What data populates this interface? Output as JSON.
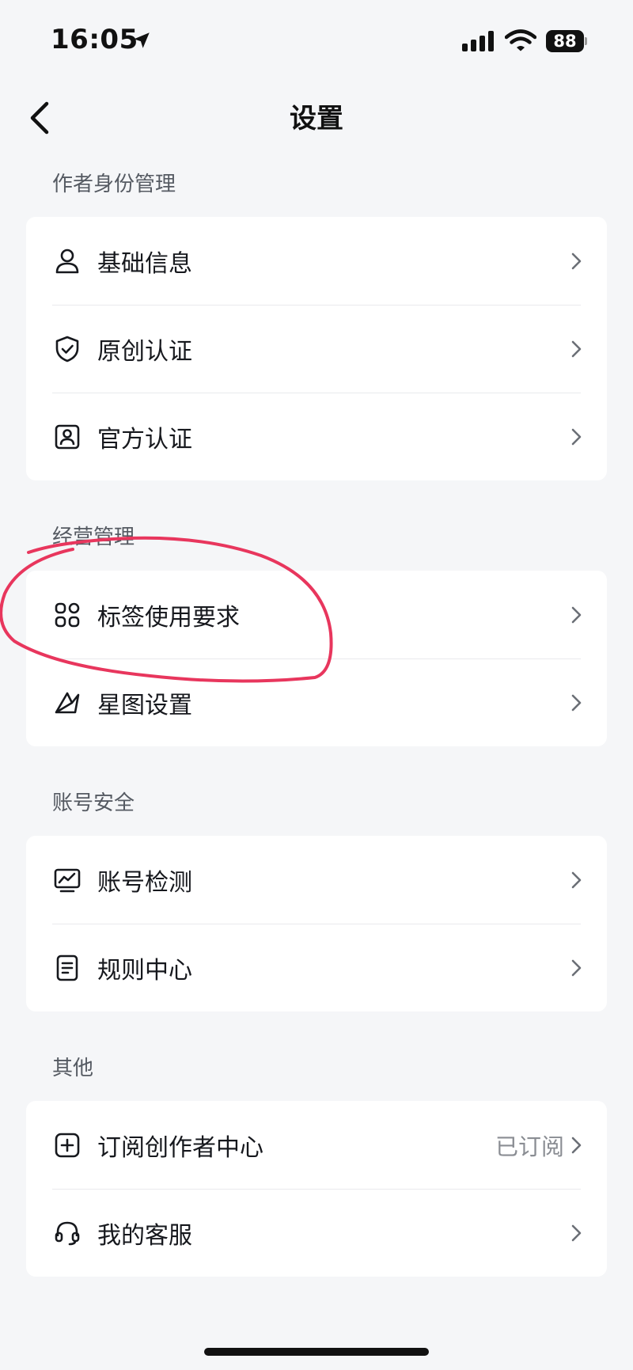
{
  "status_bar": {
    "time": "16:05",
    "battery": "88",
    "icons": [
      "location-arrow-icon",
      "cellular-signal-icon",
      "wifi-icon",
      "battery-icon"
    ]
  },
  "nav": {
    "title": "设置",
    "back_icon": "chevron-left-icon"
  },
  "sections": [
    {
      "label": "作者身份管理",
      "items": [
        {
          "label": "基础信息",
          "icon": "person-icon"
        },
        {
          "label": "原创认证",
          "icon": "shield-check-icon"
        },
        {
          "label": "官方认证",
          "icon": "id-badge-icon"
        }
      ]
    },
    {
      "label": "经营管理",
      "items": [
        {
          "label": "标签使用要求",
          "icon": "grid-four-icon"
        },
        {
          "label": "星图设置",
          "icon": "star-map-icon"
        }
      ]
    },
    {
      "label": "账号安全",
      "items": [
        {
          "label": "账号检测",
          "icon": "chart-monitor-icon"
        },
        {
          "label": "规则中心",
          "icon": "document-icon"
        }
      ]
    },
    {
      "label": "其他",
      "items": [
        {
          "label": "订阅创作者中心",
          "icon": "plus-square-icon",
          "value": "已订阅"
        },
        {
          "label": "我的客服",
          "icon": "headset-icon"
        }
      ]
    }
  ],
  "colors": {
    "background": "#f5f6f8",
    "card": "#ffffff",
    "annotation": "#e8365d",
    "secondary_text": "#8a8d93"
  }
}
